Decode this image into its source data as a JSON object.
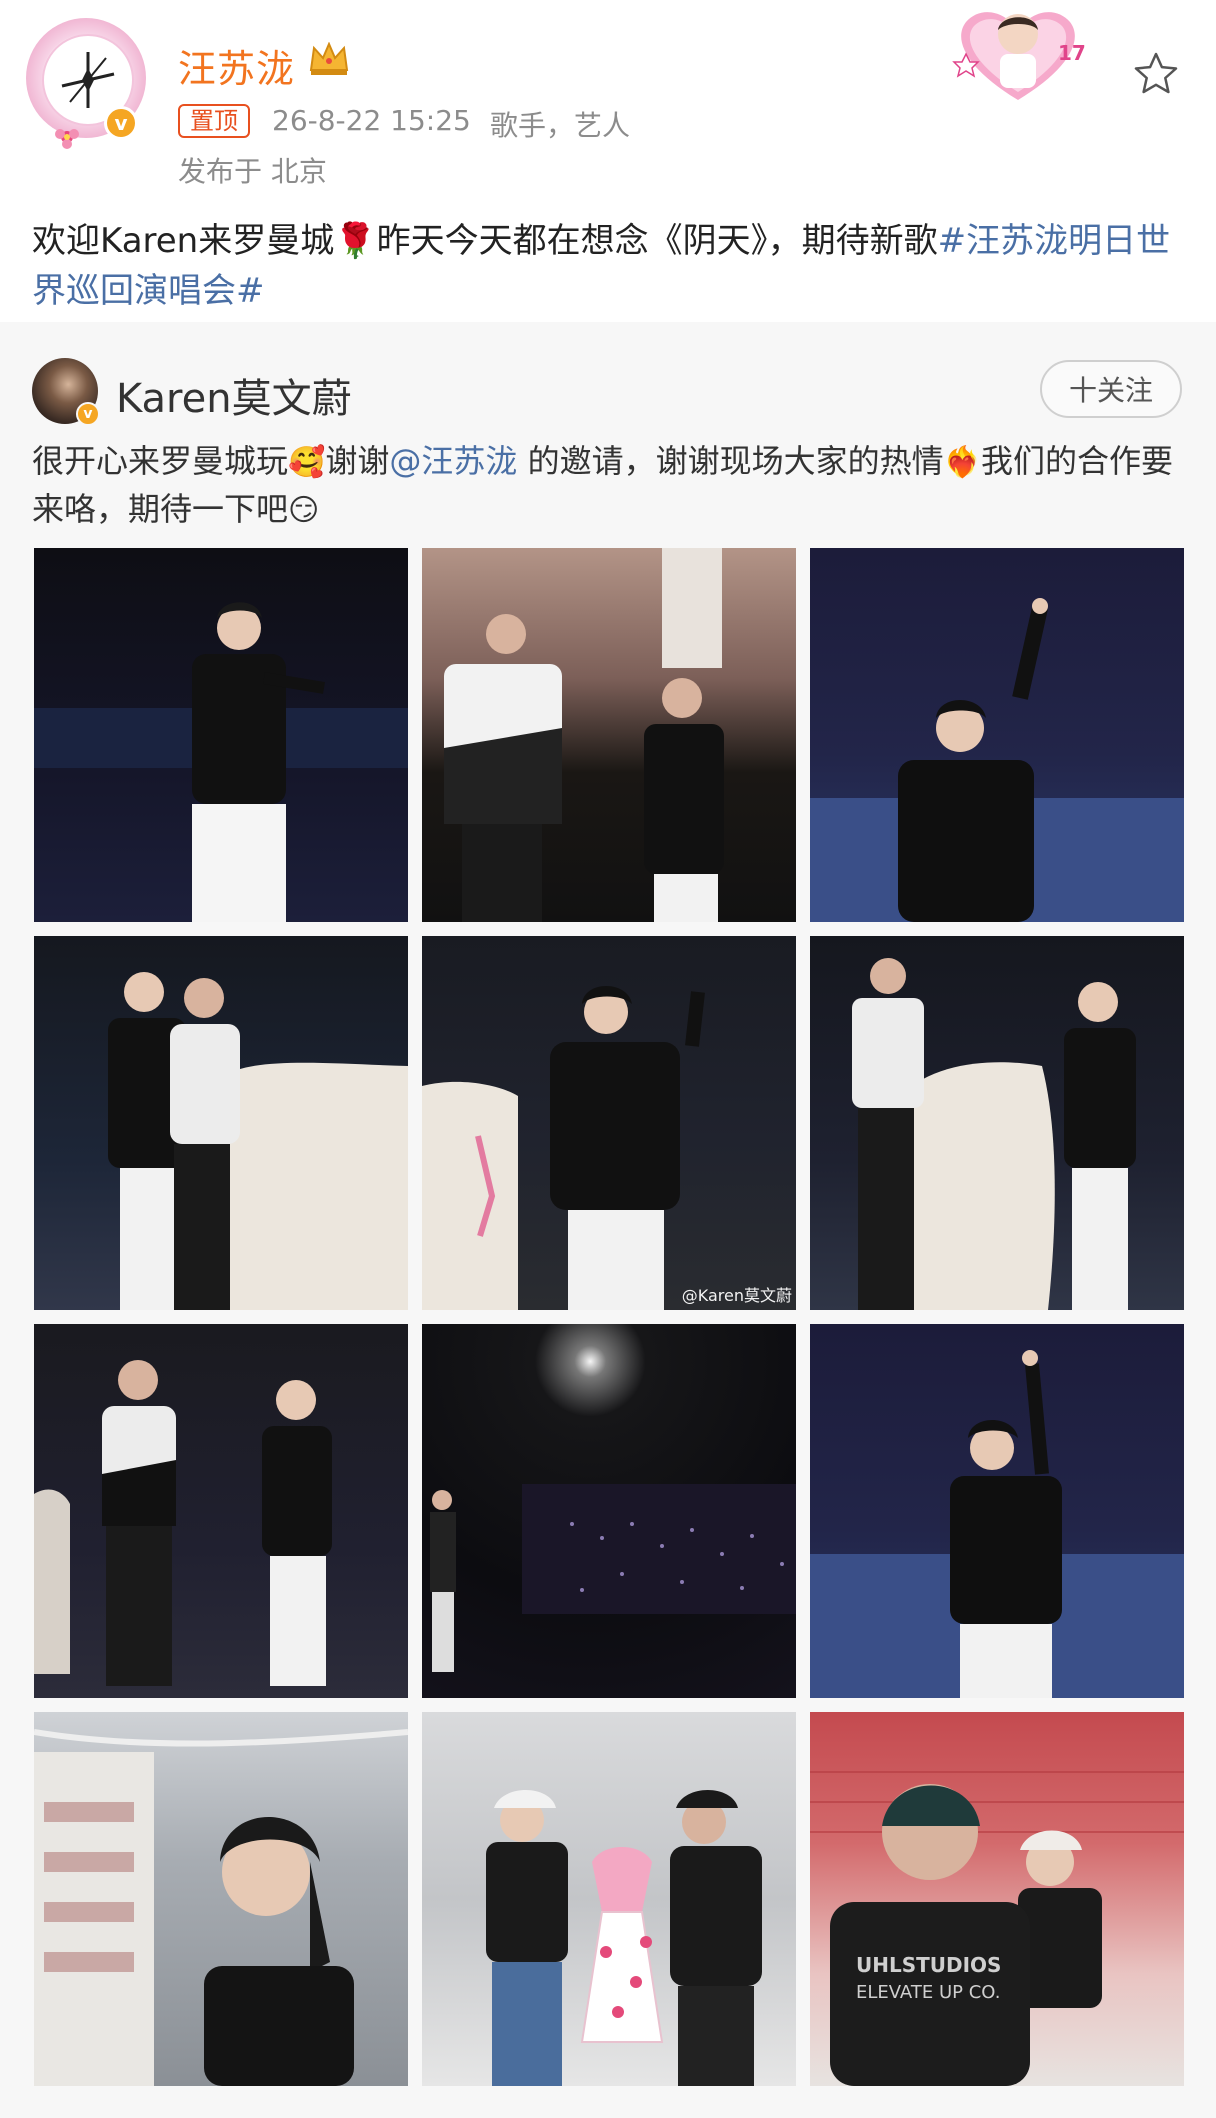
{
  "post": {
    "username": "汪苏泷",
    "pinned_label": "置顶",
    "timestamp": "26-8-22 15:25",
    "role": "歌手，艺人",
    "location": "发布于 北京",
    "text_part1": "欢迎Karen来罗曼城",
    "text_part2": "昨天今天都在想念《阴天》，期待新歌",
    "hashtag": "#汪苏泷明日世界巡回演唱会#"
  },
  "repost": {
    "username": "Karen莫文蔚",
    "follow_label": "十关注",
    "text_part1": "很开心来罗曼城玩",
    "text_part2": "谢谢",
    "mention": "@汪苏泷",
    "text_part3": " 的邀请，谢谢现场大家的热情",
    "text_part4": "我们的合作要来咯，期待一下吧",
    "photo_watermarks": [
      "@Karen莫文蔚"
    ]
  },
  "icons": {
    "star": "star-outline-icon",
    "crown": "crown-icon",
    "verified": "verified-badge-icon"
  },
  "colors": {
    "username": "#f2741f",
    "link": "#4a6fa5",
    "pin": "#e8501f",
    "verified": "#f5a623"
  }
}
